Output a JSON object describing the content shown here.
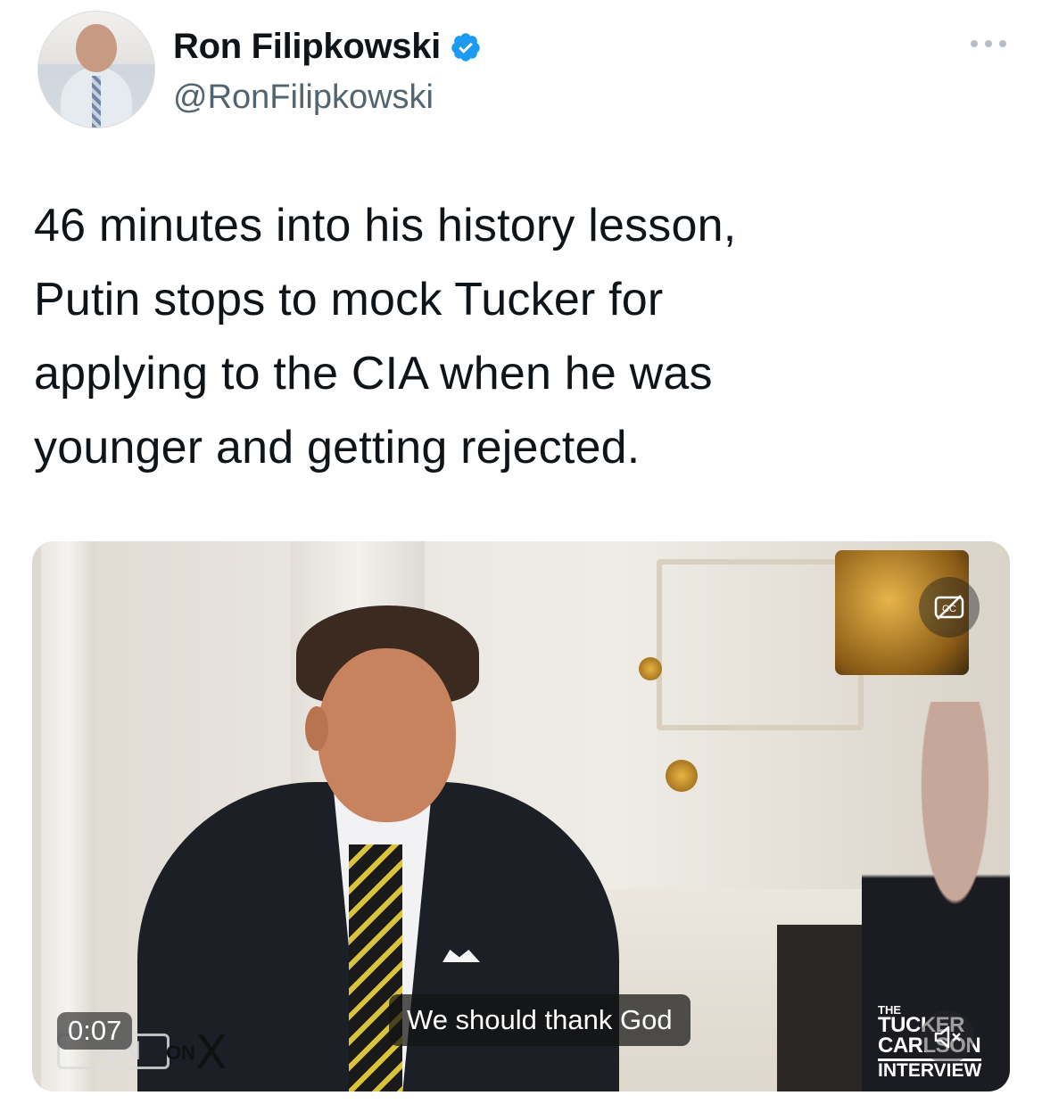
{
  "author": {
    "name": "Ron Filipkowski",
    "handle": "@RonFilipkowski",
    "verified_color": "#1d9bf0"
  },
  "more_icon": "ellipsis-icon",
  "tweet": {
    "lines": [
      "46 minutes into his history lesson,",
      "Putin stops to mock Tucker for",
      "applying to the CIA when he was",
      "younger and getting rejected."
    ]
  },
  "video": {
    "timestamp": "0:07",
    "caption": "We should thank God",
    "watermark_left": "TCN",
    "watermark_on": "ON",
    "watermark_x": "X",
    "show_logo": {
      "the": "THE",
      "line1": "TUCKER",
      "line2": "CARLSON",
      "line3": "INTERVIEW"
    },
    "cc_icon": "closed-captions-off-icon",
    "mute_icon": "speaker-muted-icon"
  }
}
